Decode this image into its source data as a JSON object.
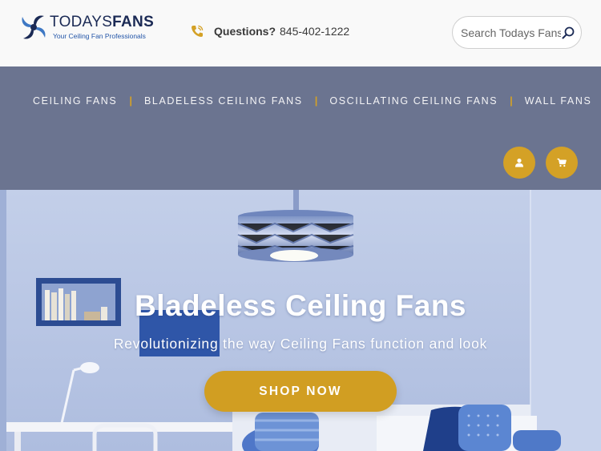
{
  "header": {
    "logo": {
      "name_light": "TODAYS",
      "name_bold": "FANS",
      "tagline": "Your Ceiling Fan Professionals"
    },
    "contact": {
      "icon": "phone-icon",
      "label": "Questions?",
      "number": "845-402-1222"
    },
    "search": {
      "placeholder": "Search Todays Fans",
      "icon": "search-icon"
    }
  },
  "nav": {
    "links": [
      {
        "label": "CEILING FANS"
      },
      {
        "label": "BLADELESS CEILING FANS"
      },
      {
        "label": "OSCILLATING CEILING FANS"
      },
      {
        "label": "WALL FANS"
      }
    ],
    "separator": "|",
    "account_icon": "user-icon",
    "cart_icon": "cart-icon"
  },
  "hero": {
    "title": "Bladeless Ceiling Fans",
    "subtitle": "Revolutionizing the way Ceiling Fans function and look",
    "cta_label": "SHOP NOW"
  },
  "colors": {
    "nav_bg": "#6b7490",
    "accent": "#d4a126",
    "logo_navy": "#1b2a55",
    "hero_wall": "#b9c7e4"
  }
}
